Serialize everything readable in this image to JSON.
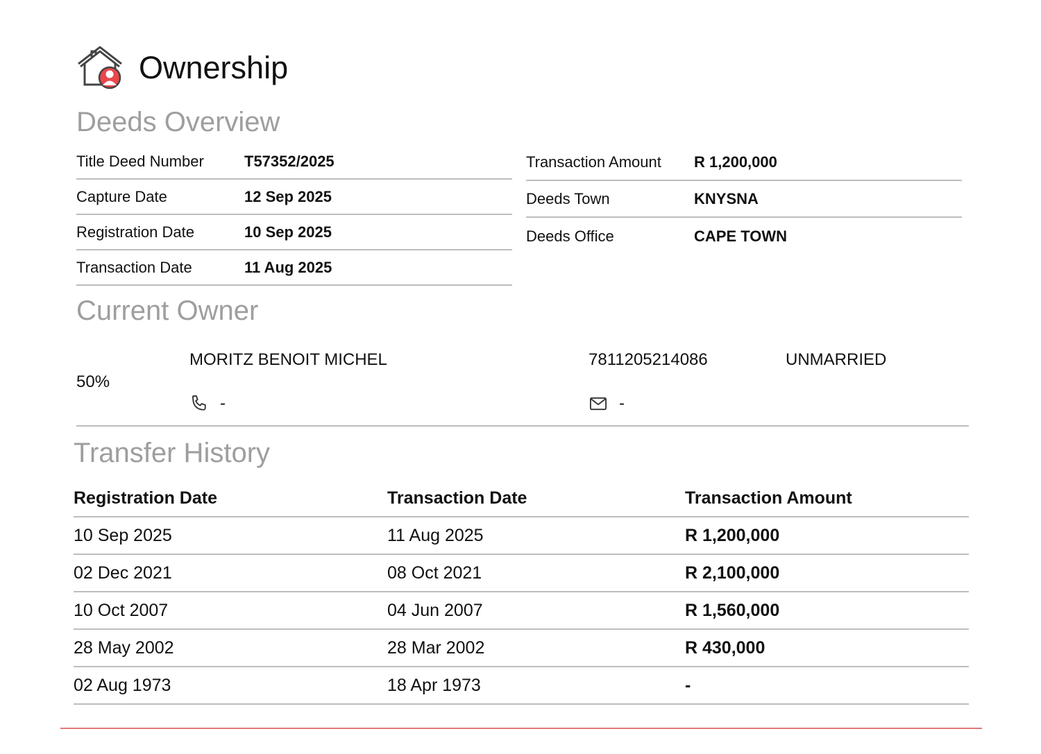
{
  "header": {
    "title": "Ownership",
    "icon": "house-owner-icon",
    "accent": "#e8474c"
  },
  "sections": {
    "overview": "Deeds Overview",
    "owner": "Current Owner",
    "history": "Transfer History"
  },
  "overview_left": [
    {
      "label": "Title Deed Number",
      "value": "T57352/2025"
    },
    {
      "label": "Capture Date",
      "value": "12 Sep 2025"
    },
    {
      "label": "Registration Date",
      "value": "10 Sep 2025"
    },
    {
      "label": "Transaction Date",
      "value": "11 Aug 2025"
    }
  ],
  "overview_right": [
    {
      "label": "Transaction Amount",
      "value": "R 1,200,000"
    },
    {
      "label": "Deeds Town",
      "value": "KNYSNA"
    },
    {
      "label": "Deeds Office",
      "value": "CAPE TOWN"
    }
  ],
  "owner": {
    "share": "50%",
    "name": "MORITZ BENOIT MICHEL",
    "id_number": "7811205214086",
    "marital_status": "UNMARRIED",
    "phone": "-",
    "email": "-"
  },
  "history": {
    "columns": [
      "Registration Date",
      "Transaction Date",
      "Transaction Amount"
    ],
    "rows": [
      [
        "10 Sep 2025",
        "11 Aug 2025",
        "R 1,200,000"
      ],
      [
        "02 Dec 2021",
        "08 Oct 2021",
        "R 2,100,000"
      ],
      [
        "10 Oct 2007",
        "04 Jun 2007",
        "R 1,560,000"
      ],
      [
        "28 May 2002",
        "28 Mar 2002",
        "R 430,000"
      ],
      [
        "02 Aug 1973",
        "18 Apr 1973",
        "-"
      ]
    ]
  }
}
